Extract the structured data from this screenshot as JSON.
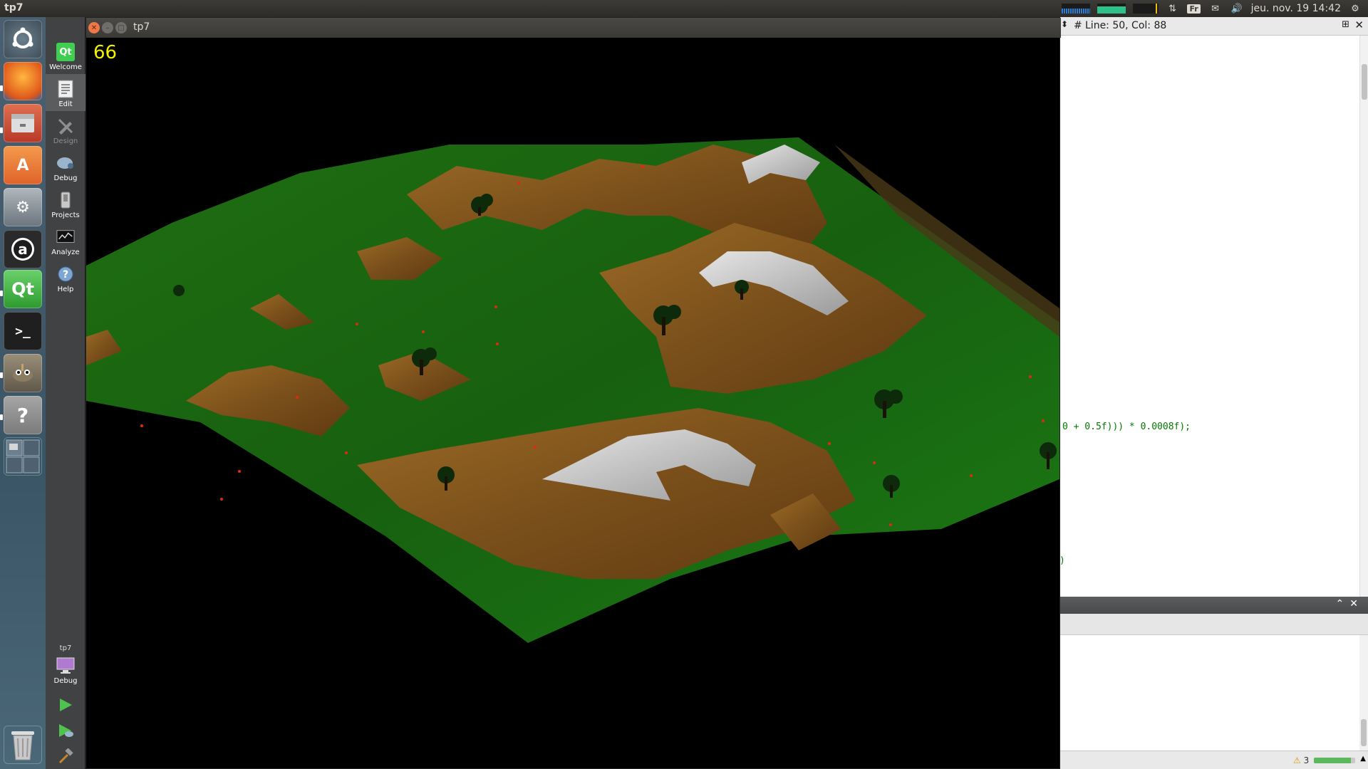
{
  "top_panel": {
    "app_title": "tp7",
    "keyboard_layout": "Fr",
    "clock": "jeu. nov. 19 14:42",
    "icons": [
      "system-monitor-cpu",
      "system-monitor-memory",
      "system-monitor-network",
      "network-transfer-icon",
      "keyboard-layout-icon",
      "mail-icon",
      "volume-icon",
      "clock",
      "session-gear-icon"
    ]
  },
  "launcher": {
    "items": [
      "dash-home",
      "firefox",
      "files",
      "software-center",
      "system-settings",
      "amazon",
      "qt-creator",
      "terminal",
      "gimp",
      "help",
      "workspace-switcher",
      "trash"
    ]
  },
  "modebar": {
    "modes": [
      {
        "label": "Welcome",
        "icon": "qt-logo-icon"
      },
      {
        "label": "Edit",
        "icon": "document-icon"
      },
      {
        "label": "Design",
        "icon": "design-pen-icon"
      },
      {
        "label": "Debug",
        "icon": "bug-icon"
      },
      {
        "label": "Projects",
        "icon": "wrench-icon"
      },
      {
        "label": "Analyze",
        "icon": "monitor-graph-icon"
      },
      {
        "label": "Help",
        "icon": "question-icon"
      }
    ],
    "target_project": "tp7",
    "target_config": "Debug"
  },
  "editor": {
    "cursor_position": "Line: 50, Col: 88",
    "hash_label": "#",
    "visible_code": "0 + 0.5f))) * 0.0008f);",
    "visible_code2": ")"
  },
  "status_bar": {
    "warnings": "3",
    "progress_fraction": 0.9
  },
  "app_window": {
    "title": "tp7",
    "fps": "66"
  }
}
